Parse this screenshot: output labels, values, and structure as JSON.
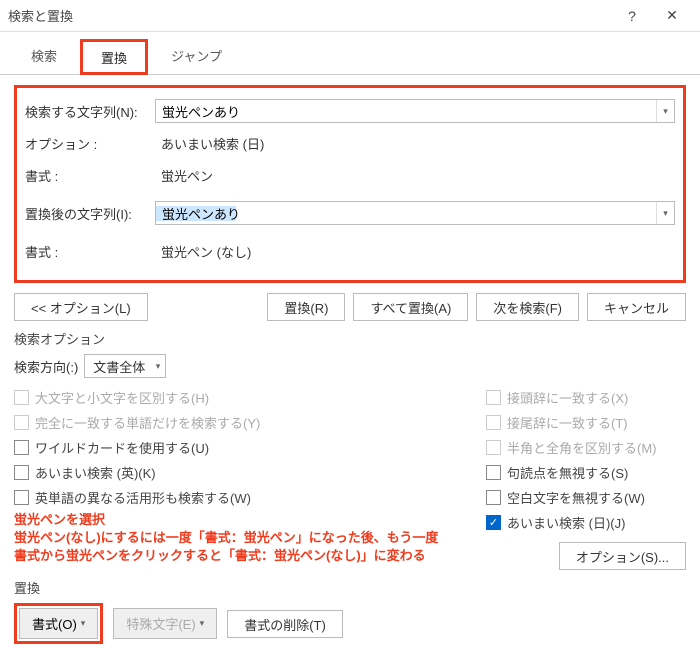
{
  "titlebar": {
    "title": "検索と置換",
    "help": "?",
    "close": "✕"
  },
  "tabs": {
    "search": "検索",
    "replace": "置換",
    "jump": "ジャンプ"
  },
  "find": {
    "label": "検索する文字列(N):",
    "value": "蛍光ペンあり",
    "opt_label": "オプション :",
    "opt_value": "あいまい検索 (日)",
    "fmt_label": "書式 :",
    "fmt_value": "蛍光ペン"
  },
  "replace": {
    "label": "置換後の文字列(I):",
    "value": "蛍光ペンあり",
    "fmt_label": "書式 :",
    "fmt_value": "蛍光ペン (なし)"
  },
  "buttons": {
    "options_toggle": "<< オプション(L)",
    "replace_one": "置換(R)",
    "replace_all": "すべて置換(A)",
    "find_next": "次を検索(F)",
    "cancel": "キャンセル"
  },
  "search_options": {
    "heading": "検索オプション",
    "direction_label": "検索方向(:)",
    "direction_value": "文書全体"
  },
  "checks": {
    "case": "大文字と小文字を区別する(H)",
    "whole": "完全に一致する単語だけを検索する(Y)",
    "wildcard": "ワイルドカードを使用する(U)",
    "fuzzy_en": "あいまい検索 (英)(K)",
    "word_forms": "英単語の異なる活用形も検索する(W)",
    "prefix": "接頭辞に一致する(X)",
    "suffix": "接尾辞に一致する(T)",
    "width": "半角と全角を区別する(M)",
    "punct": "句読点を無視する(S)",
    "space": "空白文字を無視する(W)",
    "fuzzy_jp": "あいまい検索 (日)(J)",
    "options_btn": "オプション(S)..."
  },
  "annotation": {
    "l1": "蛍光ペンを選択",
    "l2": "蛍光ペン(なし)にするには一度「書式：蛍光ペン」になった後、もう一度",
    "l3": "書式から蛍光ペンをクリックすると「書式：蛍光ペン(なし)」に変わる"
  },
  "bottom": {
    "heading": "置換",
    "format": "書式(O)",
    "special": "特殊文字(E)",
    "clear": "書式の削除(T)"
  }
}
